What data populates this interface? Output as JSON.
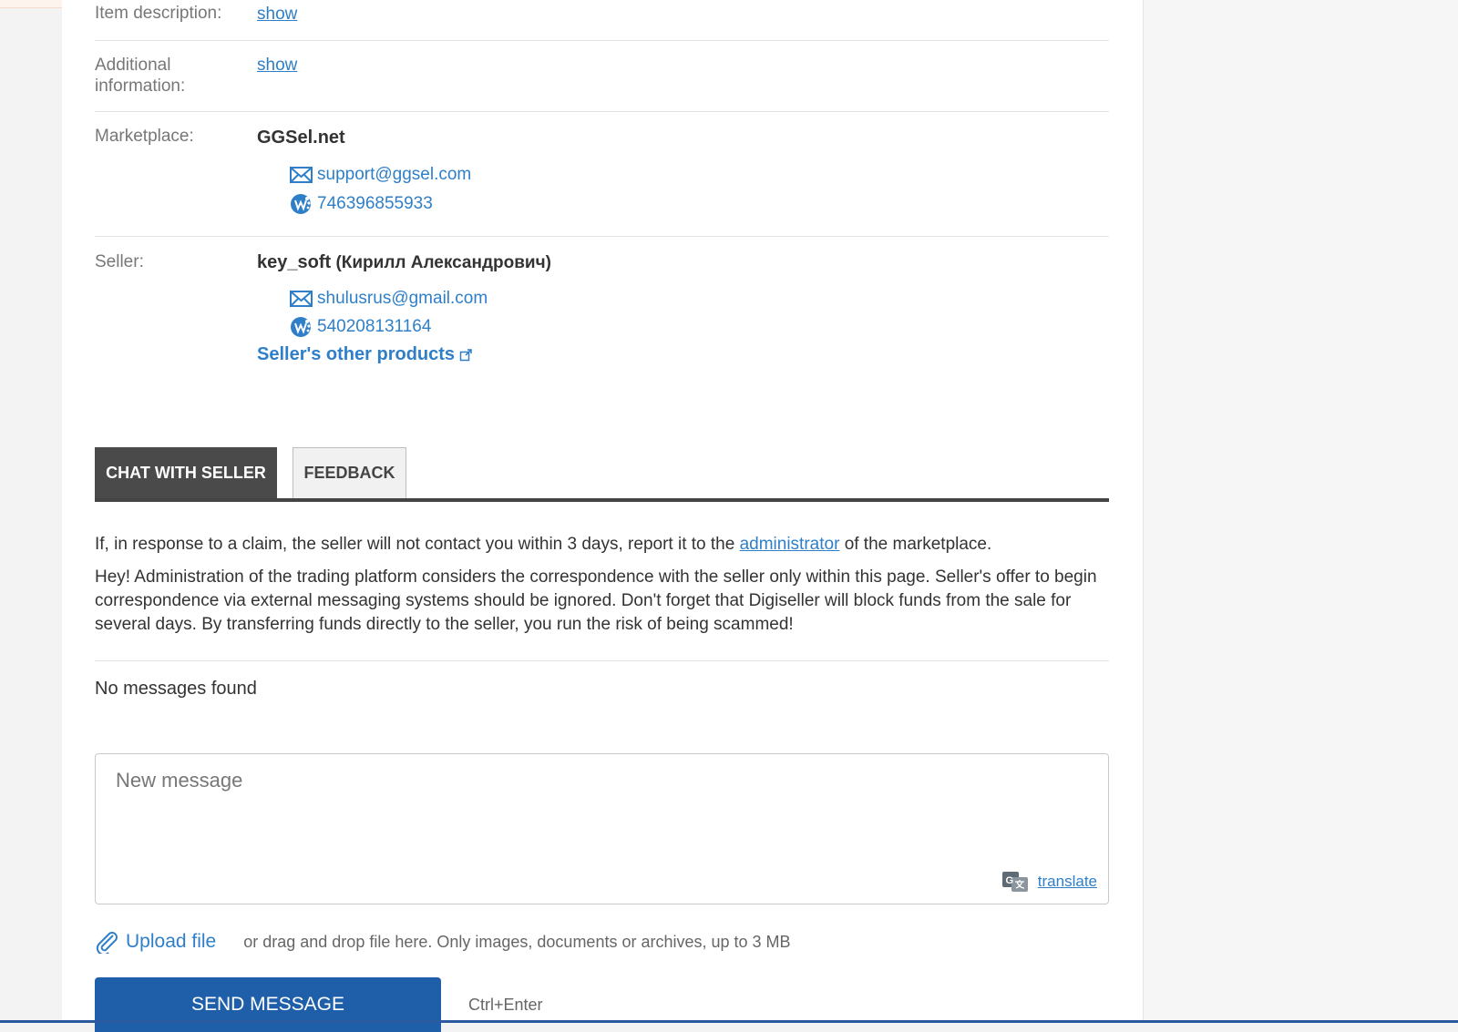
{
  "details": {
    "item_description_label": "Item description:",
    "item_description_link": "show",
    "additional_info_label": "Additional information:",
    "additional_info_link": "show",
    "marketplace_label": "Marketplace:",
    "marketplace_name": "GGSel.net",
    "marketplace_email": "support@ggsel.com",
    "marketplace_wmid": "746396855933",
    "seller_label": "Seller:",
    "seller_login": "key_soft",
    "seller_fullname": "(Кирилл Александрович)",
    "seller_email": "shulusrus@gmail.com",
    "seller_wmid": "540208131164",
    "other_products": "Seller's other products"
  },
  "tabs": {
    "chat": "CHAT WITH SELLER",
    "feedback": "FEEDBACK"
  },
  "chat": {
    "claim_prefix": "If, in response to a claim, the seller will not contact you within 3 days, report it to the",
    "claim_link": "administrator",
    "claim_suffix": "of the marketplace.",
    "warning": "Hey! Administration of the trading platform considers the correspondence with the seller only within this page. Seller's offer to begin correspondence via external messaging systems should be ignored. Don't forget that Digiseller will block funds from the sale for several days. By transferring funds directly to the seller, you run the risk of being scammed!",
    "no_messages": "No messages found",
    "placeholder": "New message",
    "translate": "translate",
    "upload_link": "Upload file",
    "upload_hint": "or drag and drop file here. Only images, documents or archives, up to 3 MB",
    "send": "SEND MESSAGE",
    "shortcut": "Ctrl+Enter"
  },
  "colors": {
    "link": "#2f7fc8",
    "active_tab": "#4a4a4a",
    "send_button": "#1f5faa"
  },
  "icons": {
    "email": "envelope-icon",
    "wmid": "webmoney-icon",
    "external": "external-link-icon",
    "translate": "google-translate-icon",
    "upload": "paperclip-icon"
  }
}
